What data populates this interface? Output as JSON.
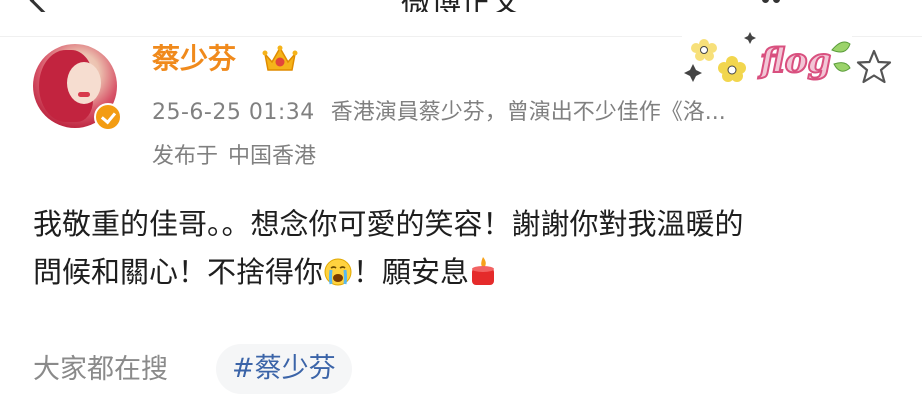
{
  "header": {
    "title": "微博正文"
  },
  "user": {
    "name": "蔡少芬",
    "avatar_alt": "蔡少芬",
    "badge": "verified-orange"
  },
  "post_meta": {
    "time": "25-6-25 01:34",
    "bio": "香港演員蔡少芬，曾演出不少佳作《洛...",
    "location_prefix": "发布于",
    "location": "中国香港"
  },
  "sticker": {
    "text": "flog"
  },
  "post": {
    "line1": "我敬重的佳哥。。想念你可愛的笑容！謝謝你對我溫暖的",
    "line2_a": "問候和關心！不捨得你",
    "line2_b": "！願安息",
    "emoji_crying": "crying-face-emoji",
    "emoji_candle": "candle-emoji"
  },
  "search": {
    "label": "大家都在搜",
    "hashtag": "#蔡少芬"
  },
  "colors": {
    "name": "#f08a1c",
    "meta": "#808080",
    "text": "#1e1e1e",
    "hashtag": "#3b64a8",
    "chip_bg": "#f5f6f7",
    "badge": "#f39c12"
  }
}
